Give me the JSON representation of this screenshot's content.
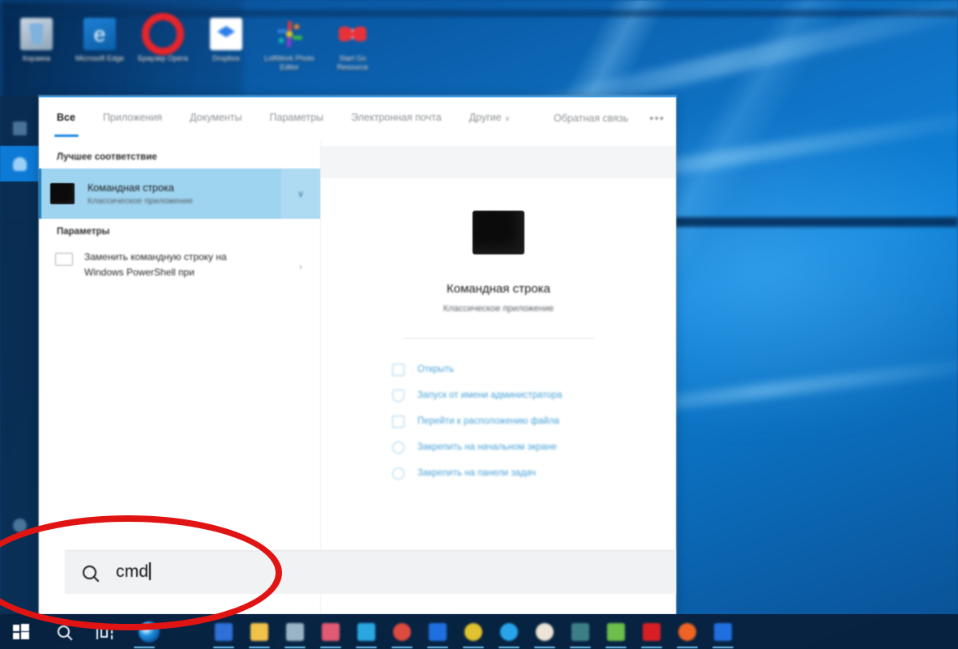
{
  "desktop": {
    "icons": [
      {
        "name": "recycle-bin",
        "label": "Корзина"
      },
      {
        "name": "microsoft-edge",
        "label": "Microsoft Edge"
      },
      {
        "name": "opera-browser",
        "label": "Браузер Opera"
      },
      {
        "name": "dropbox",
        "label": "Dropbox"
      },
      {
        "name": "photo-editor",
        "label": "LoftWork Photo Editor"
      },
      {
        "name": "red-app",
        "label": "Start Go Resource"
      }
    ]
  },
  "search_panel": {
    "tabs": [
      {
        "label": "Все",
        "selected": true
      },
      {
        "label": "Приложения",
        "selected": false
      },
      {
        "label": "Документы",
        "selected": false
      },
      {
        "label": "Параметры",
        "selected": false
      },
      {
        "label": "Электронная почта",
        "selected": false
      },
      {
        "label": "Другие",
        "selected": false,
        "chevron": "∨"
      }
    ],
    "feedback_label": "Обратная связь",
    "more_label": "•••",
    "best_match_header": "Лучшее соответствие",
    "best_match": {
      "title": "Командная строка",
      "subtitle": "Классическое приложение",
      "chevron": "∨"
    },
    "settings_header": "Параметры",
    "settings_items": [
      {
        "label": "Заменить командную строку на Windows PowerShell при",
        "chevron": "›"
      }
    ],
    "preview": {
      "title": "Командная строка",
      "subtitle": "Классическое приложение",
      "actions": [
        {
          "icon": "open-icon",
          "label": "Открыть"
        },
        {
          "icon": "shield-icon",
          "label": "Запуск от имени администратора"
        },
        {
          "icon": "folder-icon",
          "label": "Перейти к расположению файла"
        },
        {
          "icon": "pin-icon",
          "label": "Закрепить на начальном экране"
        },
        {
          "icon": "pin-taskbar-icon",
          "label": "Закрепить на панели задач"
        }
      ]
    }
  },
  "search_box": {
    "value": "cmd",
    "icon": "search-icon"
  },
  "start_rail": {
    "items": [
      {
        "name": "start-rail-item-documents",
        "active": false
      },
      {
        "name": "start-rail-item-pictures",
        "active": true
      },
      {
        "name": "start-rail-item-power",
        "active": false
      }
    ]
  },
  "taskbar": {
    "start_label": "Пуск",
    "search_label": "Поиск",
    "taskview_label": "Представление задач",
    "pinned": [
      {
        "name": "edge-browser",
        "color": "#1f7fd1",
        "running": true
      },
      {
        "name": "file-explorer",
        "color": "#f2c14a",
        "running": true
      },
      {
        "name": "store",
        "color": "#7bbde0",
        "running": false
      },
      {
        "name": "mail-app",
        "color": "#2f6fd6",
        "running": true
      },
      {
        "name": "telegram-app",
        "color": "#2aa7e0",
        "running": true
      },
      {
        "name": "chrome-browser",
        "color": "#dd4b3e",
        "running": true
      },
      {
        "name": "skype-app",
        "color": "#1fa3e8",
        "running": true
      },
      {
        "name": "opera-app",
        "color": "#e2c22e",
        "running": true
      },
      {
        "name": "steam-app",
        "color": "#27a5e8",
        "running": true
      },
      {
        "name": "clock-app",
        "color": "#e8e1d4",
        "running": true
      },
      {
        "name": "notepad-app",
        "color": "#3b7f86",
        "running": true
      },
      {
        "name": "excel-app",
        "color": "#6cc04a",
        "running": true
      },
      {
        "name": "adobe-app",
        "color": "#d81f26",
        "running": true
      },
      {
        "name": "vlc-app",
        "color": "#ef6325",
        "running": true
      },
      {
        "name": "blue-app",
        "color": "#1f6fe0",
        "running": true
      }
    ]
  },
  "annotation": {
    "name": "red-ellipse-highlight",
    "color": "#e11414"
  }
}
